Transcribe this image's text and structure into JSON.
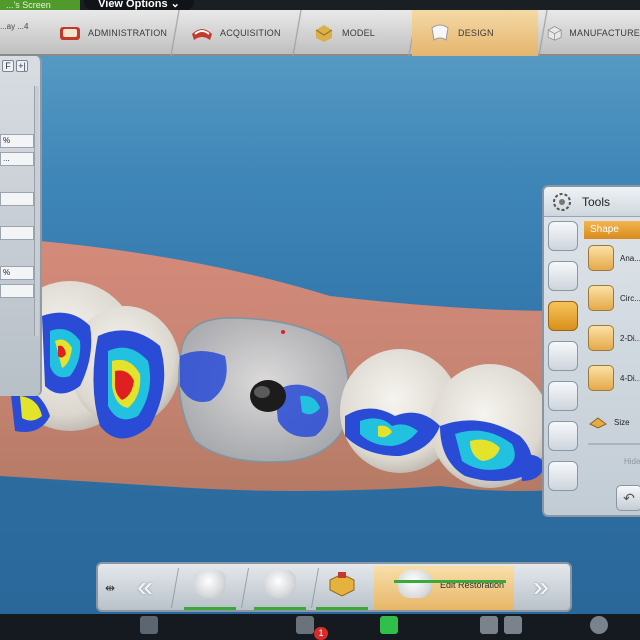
{
  "top": {
    "screen_tab": "...'s Screen",
    "view_options": "View Options ⌄",
    "left_info": "...ay ...4"
  },
  "workflow": {
    "steps": [
      {
        "label": "ADMINISTRATION",
        "active": false
      },
      {
        "label": "ACQUISITION",
        "active": false
      },
      {
        "label": "MODEL",
        "active": false
      },
      {
        "label": "DESIGN",
        "active": true
      },
      {
        "label": "MANUFACTURE",
        "active": false
      }
    ]
  },
  "left_panel": {
    "btn_a": "F",
    "btn_b": "+|",
    "rows": [
      "%",
      "...",
      "",
      "",
      "%",
      ""
    ]
  },
  "tools": {
    "title": "Tools",
    "section": "Shape",
    "items": [
      {
        "label": "Ana...",
        "icon": "anatomic-icon"
      },
      {
        "label": "Circ...",
        "icon": "circular-icon"
      },
      {
        "label": "2-Di...",
        "icon": "2d-icon"
      },
      {
        "label": "4-Di...",
        "icon": "4d-icon"
      },
      {
        "label": "Size",
        "icon": "size-icon"
      }
    ],
    "hide_label": "Hide",
    "undo": "↶"
  },
  "bottom": {
    "active_label": "Edit Restoration",
    "notification_count": "1"
  },
  "colors": {
    "accent_orange": "#e4b56c",
    "progress_green": "#3aa83a",
    "background_blue": "#3f86b8"
  }
}
